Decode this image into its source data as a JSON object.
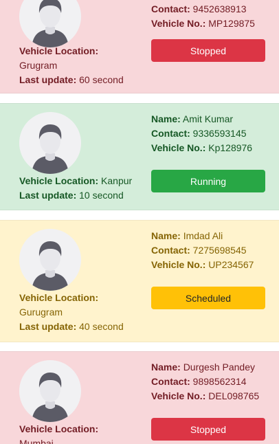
{
  "labels": {
    "name": "Name:",
    "contact": "Contact:",
    "vehicle_no": "Vehicle No.:",
    "vehicle_location": "Vehicle Location:",
    "last_update": "Last update:"
  },
  "colors": {
    "danger_bg": "#f8d7da",
    "success_bg": "#d4edda",
    "warning_bg": "#fff3cd",
    "danger_button": "#dc3545",
    "success_button": "#28a745",
    "warning_button": "#ffc107"
  },
  "vehicles": [
    {
      "name": "",
      "contact": "9452638913",
      "vehicle_no": "MP129875",
      "location": "Grugram",
      "last_update": "60 second",
      "status": "Stopped",
      "avatar_icon": "user-avatar-icon"
    },
    {
      "name": "Amit Kumar",
      "contact": "9336593145",
      "vehicle_no": "Kp128976",
      "location": "Kanpur",
      "last_update": "10 second",
      "status": "Running",
      "avatar_icon": "user-avatar-icon"
    },
    {
      "name": "Imdad Ali",
      "contact": "7275698545",
      "vehicle_no": "UP234567",
      "location": "Gurugram",
      "last_update": "40 second",
      "status": "Scheduled",
      "avatar_icon": "user-avatar-icon"
    },
    {
      "name": "Durgesh Pandey",
      "contact": "9898562314",
      "vehicle_no": "DEL098765",
      "location": "Mumbai",
      "last_update": "",
      "status": "Stopped",
      "avatar_icon": "user-avatar-icon"
    }
  ]
}
